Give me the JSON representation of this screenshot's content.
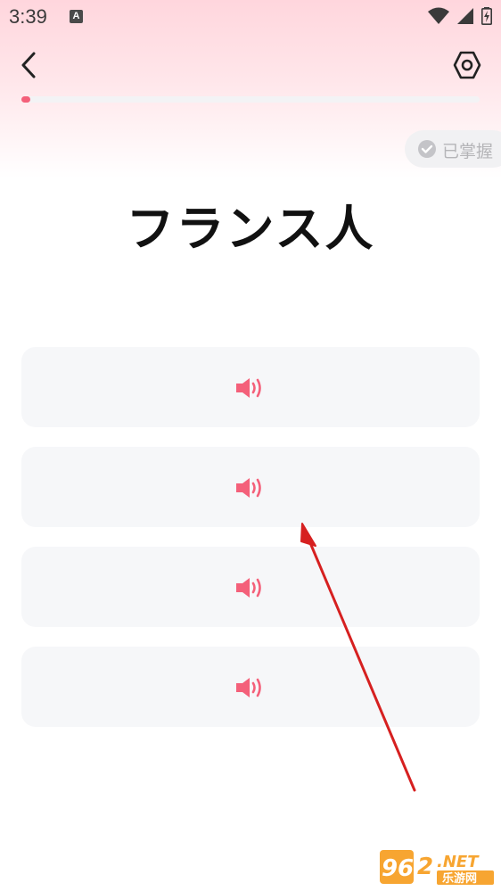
{
  "status_bar": {
    "time": "3:39",
    "notification_icon_letter": "A"
  },
  "header": {
    "back_icon": "chevron-left-icon",
    "settings_icon": "hexagon-settings-icon"
  },
  "progress": {
    "fraction": 0.02,
    "color": "#f4607a"
  },
  "mastered_button": {
    "label": "已掌握"
  },
  "word": {
    "text": "フランス人"
  },
  "options": [
    {
      "icon": "speaker-icon"
    },
    {
      "icon": "speaker-icon"
    },
    {
      "icon": "speaker-icon"
    },
    {
      "icon": "speaker-icon"
    }
  ],
  "colors": {
    "accent": "#f4607a",
    "card_bg": "#f6f7f9",
    "annotation_arrow": "#d62020"
  },
  "watermark": {
    "brand_number": "962",
    "brand_suffix": ".NET",
    "brand_text": "乐游网"
  }
}
